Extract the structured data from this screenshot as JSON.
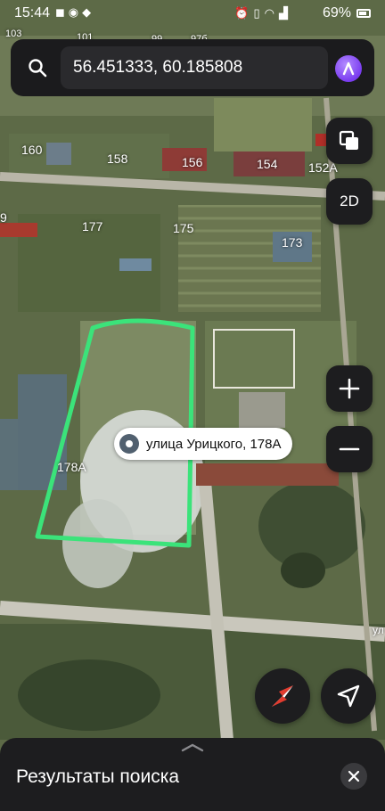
{
  "status_bar": {
    "time": "15:44",
    "battery": "69%",
    "left_icons": [
      "vk-icon",
      "whatsapp-icon",
      "messenger-icon"
    ],
    "right_icons": [
      "alarm-icon",
      "vibrate-icon",
      "wifi-icon",
      "signal-icon"
    ]
  },
  "search": {
    "query": "56.451333, 60.185808",
    "assistant_icon": "alice-icon"
  },
  "map_controls": {
    "layers_icon": "layers-icon",
    "mode_label": "2D",
    "zoom_in_icon": "plus-icon",
    "zoom_out_icon": "minus-icon",
    "compass_icon": "compass-icon",
    "locate_icon": "location-arrow-icon"
  },
  "map": {
    "house_numbers": [
      "103",
      "101",
      "99",
      "97б",
      "160",
      "158",
      "156",
      "154",
      "152А",
      "9",
      "177",
      "175",
      "173",
      "178А"
    ],
    "road_label": "ул",
    "selected_place": "улица Урицкого, 178А",
    "outline_color": "#3be37a"
  },
  "bottom_sheet": {
    "title": "Результаты поиска",
    "close_icon": "close-icon"
  }
}
